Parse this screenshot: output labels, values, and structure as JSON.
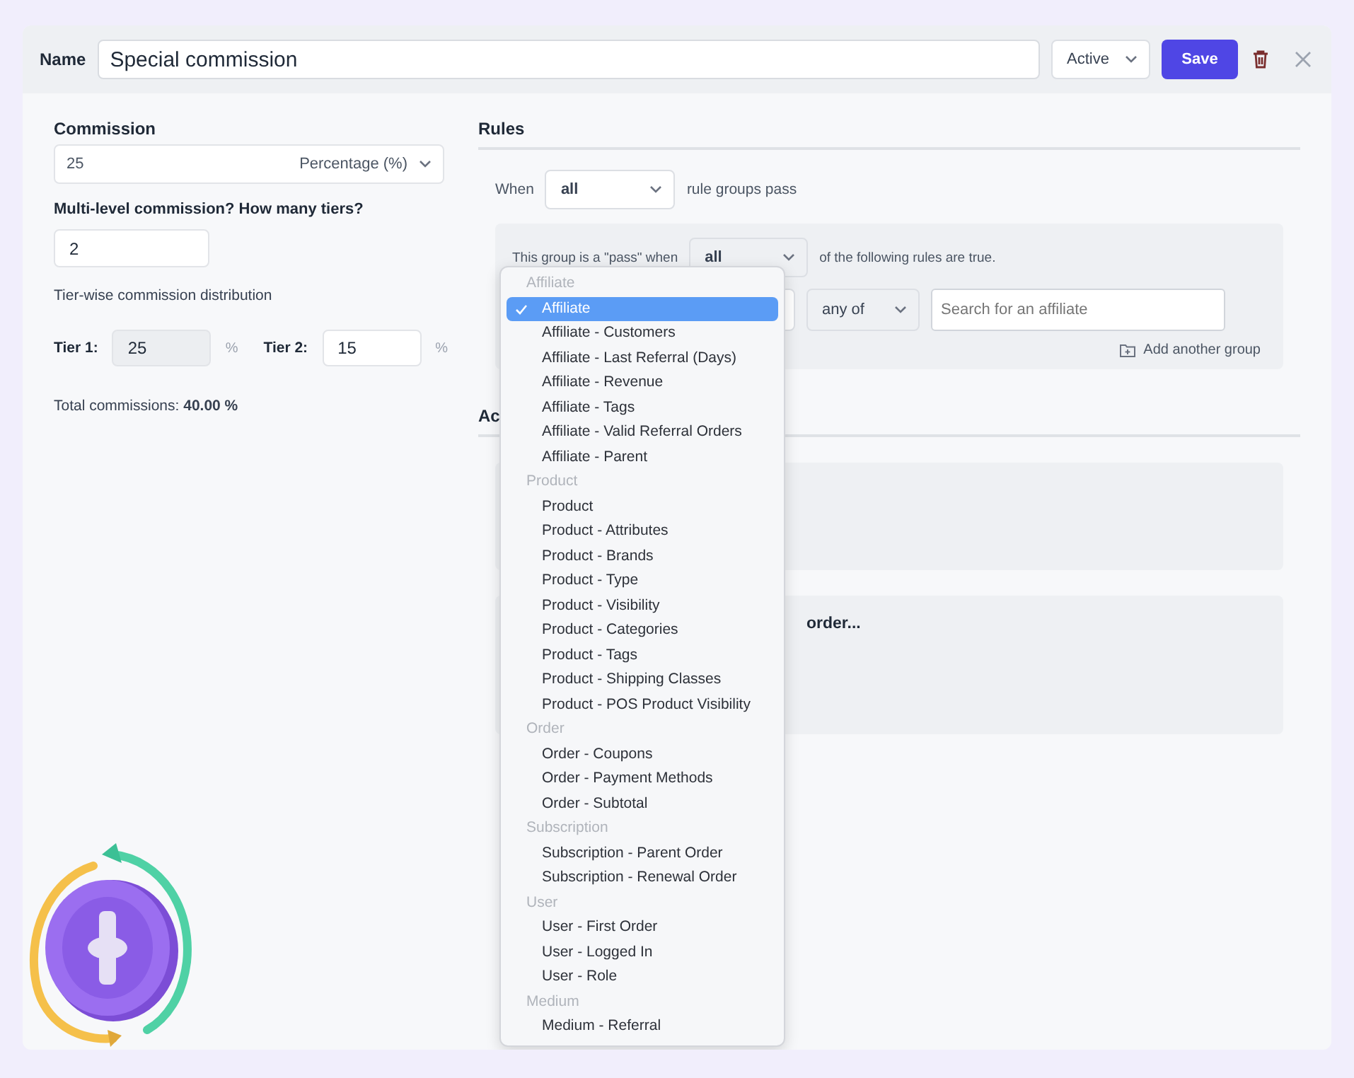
{
  "header": {
    "name_label": "Name",
    "name_value": "Special commission",
    "status": "Active",
    "save": "Save"
  },
  "commission": {
    "label": "Commission",
    "value": "25",
    "type": "Percentage (%)",
    "tiers_label": "Multi-level commission? How many tiers?",
    "tiers_value": "2",
    "distribution_label": "Tier-wise commission distribution",
    "tiers": [
      {
        "label": "Tier 1:",
        "value": "25",
        "disabled": true,
        "unit": "%"
      },
      {
        "label": "Tier 2:",
        "value": "15",
        "disabled": false,
        "unit": "%"
      }
    ],
    "total": "Total commissions: **40.00 %**"
  },
  "rules": {
    "heading": "Rules",
    "when_label": "When",
    "when_value": "all",
    "when_suffix": "rule groups pass",
    "group": {
      "prefix": "This group is a \"pass\" when",
      "match": "all",
      "suffix": "of the following rules are true.",
      "operator": "any of",
      "search_placeholder": "Search for an affiliate"
    },
    "add_group": "Add another group"
  },
  "actions": {
    "heading": "Ac",
    "visible_text": "order..."
  },
  "dropdown": {
    "groups": [
      {
        "label": "Affiliate",
        "options": [
          {
            "label": "Affiliate",
            "selected": true
          },
          {
            "label": "Affiliate - Customers",
            "selected": false
          },
          {
            "label": "Affiliate - Last Referral (Days)",
            "selected": false
          },
          {
            "label": "Affiliate - Revenue",
            "selected": false
          },
          {
            "label": "Affiliate - Tags",
            "selected": false
          },
          {
            "label": "Affiliate - Valid Referral Orders",
            "selected": false
          },
          {
            "label": "Affiliate - Parent",
            "selected": false
          }
        ]
      },
      {
        "label": "Product",
        "options": [
          {
            "label": "Product",
            "selected": false
          },
          {
            "label": "Product - Attributes",
            "selected": false
          },
          {
            "label": "Product - Brands",
            "selected": false
          },
          {
            "label": "Product - Type",
            "selected": false
          },
          {
            "label": "Product - Visibility",
            "selected": false
          },
          {
            "label": "Product - Categories",
            "selected": false
          },
          {
            "label": "Product - Tags",
            "selected": false
          },
          {
            "label": "Product - Shipping Classes",
            "selected": false
          },
          {
            "label": "Product - POS Product Visibility",
            "selected": false
          }
        ]
      },
      {
        "label": "Order",
        "options": [
          {
            "label": "Order - Coupons",
            "selected": false
          },
          {
            "label": "Order - Payment Methods",
            "selected": false
          },
          {
            "label": "Order - Subtotal",
            "selected": false
          }
        ]
      },
      {
        "label": "Subscription",
        "options": [
          {
            "label": "Subscription - Parent Order",
            "selected": false
          },
          {
            "label": "Subscription - Renewal Order",
            "selected": false
          }
        ]
      },
      {
        "label": "User",
        "options": [
          {
            "label": "User - First Order",
            "selected": false
          },
          {
            "label": "User - Logged In",
            "selected": false
          },
          {
            "label": "User - Role",
            "selected": false
          }
        ]
      },
      {
        "label": "Medium",
        "options": [
          {
            "label": "Medium - Referral",
            "selected": false
          }
        ]
      }
    ]
  }
}
